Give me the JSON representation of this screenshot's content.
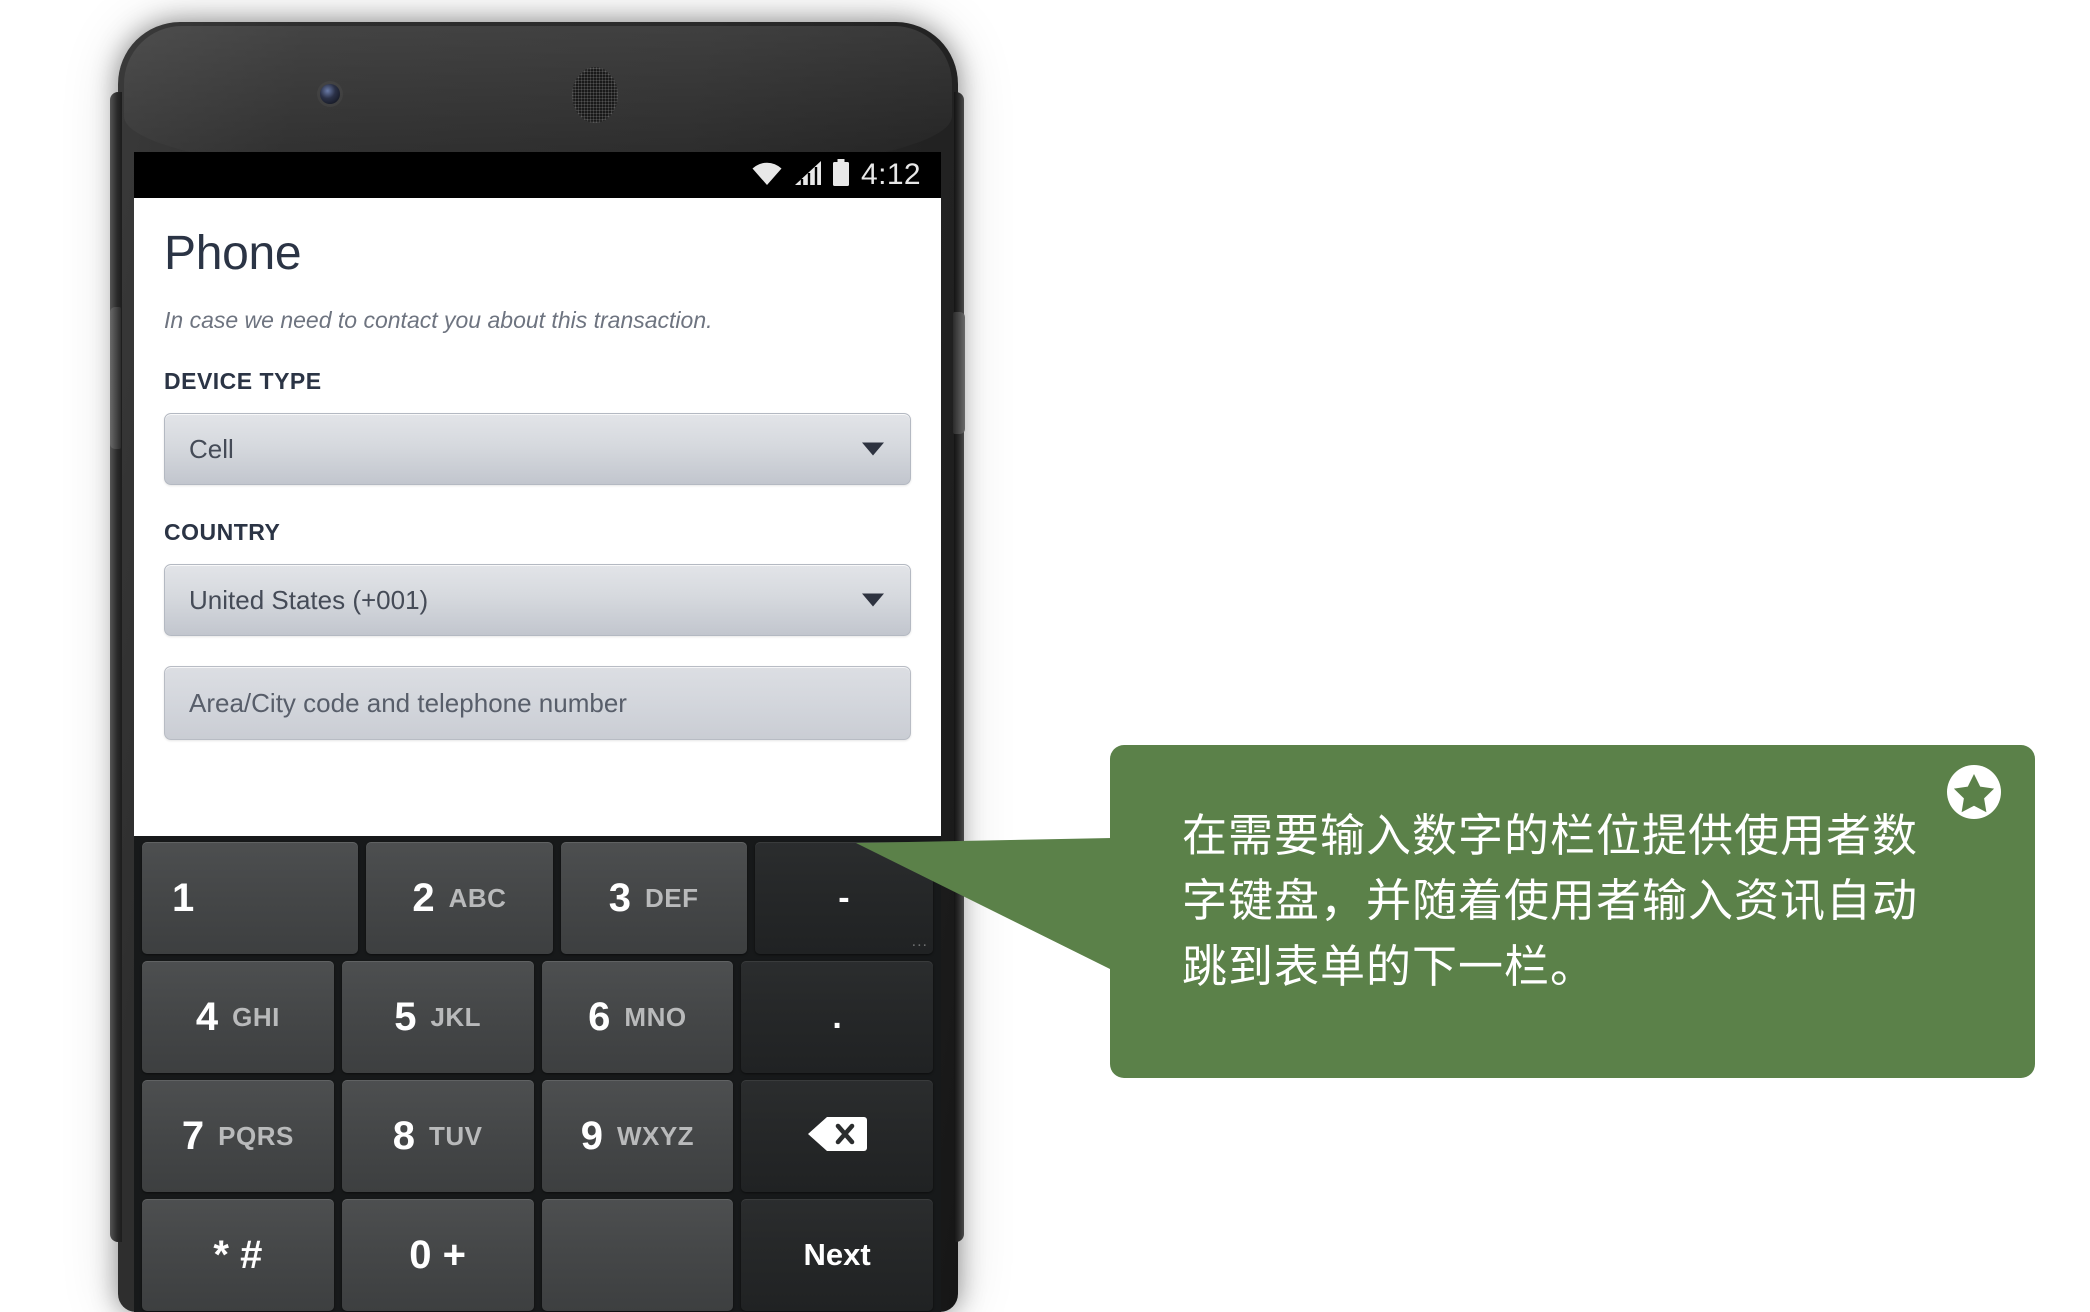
{
  "device": {
    "status_bar": {
      "wifi_icon": "wifi-icon",
      "signal_icon": "signal-bars-icon",
      "battery_icon": "battery-icon",
      "time": "4:12"
    },
    "camera_icon": "front-camera-icon",
    "speaker_icon": "earpiece-speaker-icon",
    "volume_button": "volume-rocker-button",
    "power_button": "power-button"
  },
  "form": {
    "title": "Phone",
    "subtitle": "In case we need to contact you about this transaction.",
    "fields": [
      {
        "label": "DEVICE TYPE",
        "type": "select",
        "value": "Cell",
        "caret_icon": "chevron-down-icon"
      },
      {
        "label": "COUNTRY",
        "type": "select",
        "value": "United States (+001)",
        "caret_icon": "chevron-down-icon"
      }
    ],
    "phone_input": {
      "placeholder": "Area/City code and telephone number",
      "value": ""
    }
  },
  "keypad": {
    "rows": [
      [
        {
          "digit": "1",
          "letters": "",
          "kind": "digit"
        },
        {
          "digit": "2",
          "letters": "ABC",
          "kind": "digit"
        },
        {
          "digit": "3",
          "letters": "DEF",
          "kind": "digit"
        },
        {
          "symbol": "-",
          "kind": "fn-dash",
          "hint": "..."
        }
      ],
      [
        {
          "digit": "4",
          "letters": "GHI",
          "kind": "digit"
        },
        {
          "digit": "5",
          "letters": "JKL",
          "kind": "digit"
        },
        {
          "digit": "6",
          "letters": "MNO",
          "kind": "digit"
        },
        {
          "symbol": ".",
          "kind": "fn-dot"
        }
      ],
      [
        {
          "digit": "7",
          "letters": "PQRS",
          "kind": "digit"
        },
        {
          "digit": "8",
          "letters": "TUV",
          "kind": "digit"
        },
        {
          "digit": "9",
          "letters": "WXYZ",
          "kind": "digit"
        },
        {
          "icon": "backspace-icon",
          "kind": "fn-backspace"
        }
      ],
      [
        {
          "symbol": "* #",
          "kind": "digit-sym"
        },
        {
          "symbol": "0 +",
          "kind": "digit-sym"
        },
        {
          "symbol": "",
          "kind": "digit-space"
        },
        {
          "label": "Next",
          "kind": "fn-next"
        }
      ]
    ]
  },
  "callout": {
    "text": "在需要输入数字的栏位提供使用者数字键盘，并随着使用者输入资讯自动跳到表单的下一栏。",
    "star_icon": "star-badge-icon",
    "color": "#5b8149",
    "pointer_icon": "callout-pointer-triangle"
  }
}
